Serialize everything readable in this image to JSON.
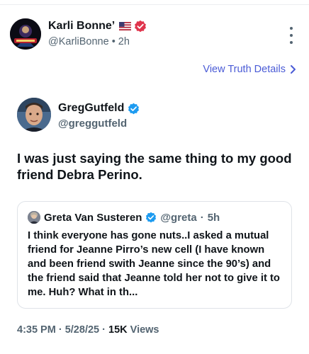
{
  "post": {
    "author_name": "Karli Bonne’",
    "author_handle": "@KarliBonne",
    "separator": "•",
    "age": "2h",
    "view_details_label": "View Truth Details"
  },
  "reposted": {
    "name": "GregGutfeld",
    "handle": "@greggutfeld",
    "text": "I was just saying the same thing to my good friend Debra Perino."
  },
  "quote": {
    "name": "Greta Van Susteren",
    "handle": "@greta",
    "dot": "·",
    "age": "5h",
    "text": "I think everyone has gone nuts..I asked a mutual friend for Jeanne Pirro’s new cell (I have known and been friend swith Jeanne since the 90’s) and the friend said that Jeanne told her not to give it to me.  Huh? What in th..."
  },
  "meta": {
    "time": "4:35 PM",
    "dot1": "·",
    "date": "5/28/25",
    "dot2": "·",
    "views_count": "15K",
    "views_label": "Views"
  },
  "colors": {
    "accent_link": "#4a5bd6",
    "verified_red": "#e0344c",
    "verified_blue": "#1d9bf0",
    "muted_text": "#536471"
  },
  "icons": {
    "flag": "us-flag-icon",
    "verified_red": "verified-badge-icon",
    "verified_blue": "verified-badge-icon",
    "more": "more-vertical-icon",
    "chevron": "chevron-right-icon"
  }
}
